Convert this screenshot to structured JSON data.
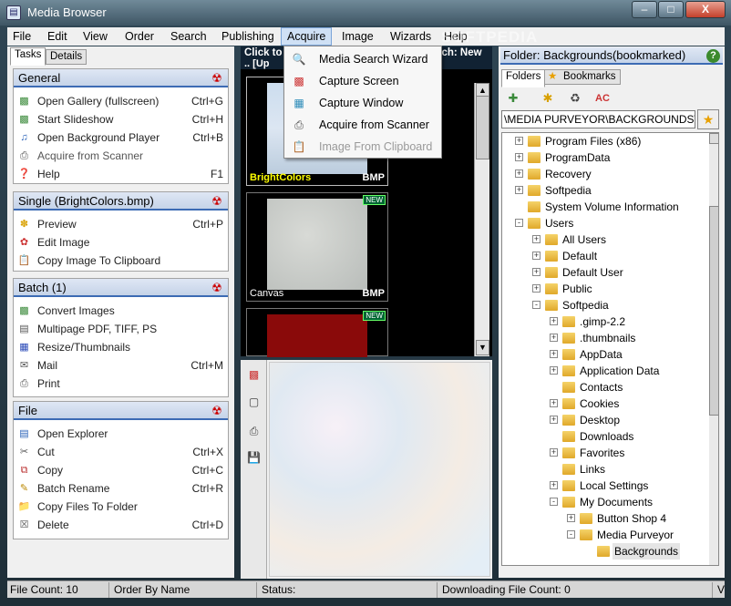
{
  "window": {
    "title": "Media Browser",
    "min_label": "–",
    "max_label": "□",
    "close_label": "X"
  },
  "menu": [
    "File",
    "Edit",
    "View",
    "Order",
    "Search",
    "Publishing",
    "Acquire",
    "Image",
    "Wizards",
    "Help"
  ],
  "watermark": "SOFTPEDIA",
  "left_tabs": [
    "Tasks",
    "Details"
  ],
  "groups": {
    "general": {
      "title": "General",
      "items": [
        {
          "label": "Open Gallery (fullscreen)",
          "shortcut": "Ctrl+G"
        },
        {
          "label": "Start Slideshow",
          "shortcut": "Ctrl+H"
        },
        {
          "label": "Open Background Player",
          "shortcut": "Ctrl+B"
        },
        {
          "label": "Acquire from Scanner",
          "shortcut": ""
        },
        {
          "label": "Help",
          "shortcut": "F1"
        }
      ]
    },
    "single": {
      "title": "Single (BrightColors.bmp)",
      "items": [
        {
          "label": "Preview",
          "shortcut": "Ctrl+P"
        },
        {
          "label": "Edit Image",
          "shortcut": ""
        },
        {
          "label": "Copy Image To Clipboard",
          "shortcut": ""
        }
      ]
    },
    "batch": {
      "title": "Batch (1)",
      "items": [
        {
          "label": "Convert Images",
          "shortcut": ""
        },
        {
          "label": "Multipage PDF, TIFF, PS",
          "shortcut": ""
        },
        {
          "label": "Resize/Thumbnails",
          "shortcut": ""
        },
        {
          "label": "Mail",
          "shortcut": "Ctrl+M"
        },
        {
          "label": "Print",
          "shortcut": ""
        }
      ]
    },
    "file": {
      "title": "File",
      "items": [
        {
          "label": "Open Explorer",
          "shortcut": ""
        },
        {
          "label": "Cut",
          "shortcut": "Ctrl+X"
        },
        {
          "label": "Copy",
          "shortcut": "Ctrl+C"
        },
        {
          "label": "Batch Rename",
          "shortcut": "Ctrl+R"
        },
        {
          "label": "Copy Files To Folder",
          "shortcut": ""
        },
        {
          "label": "Delete",
          "shortcut": "Ctrl+D"
        }
      ]
    }
  },
  "mid": {
    "header1": "Click to",
    "header1_right": "rch: New",
    "header2": ".. [Up",
    "thumbs": [
      {
        "name": "BrightColors",
        "ext": "BMP",
        "new": ""
      },
      {
        "name": "Canvas",
        "ext": "BMP",
        "new": "NEW"
      },
      {
        "name": "",
        "ext": "",
        "new": "NEW"
      }
    ]
  },
  "acquire_menu": [
    {
      "label": "Media Search Wizard",
      "enabled": true
    },
    {
      "label": "Capture Screen",
      "enabled": true
    },
    {
      "label": "Capture Window",
      "enabled": true
    },
    {
      "label": "Acquire from Scanner",
      "enabled": true
    },
    {
      "label": "Image From Clipboard",
      "enabled": false
    }
  ],
  "right": {
    "folder_title": "Folder: Backgrounds(bookmarked)",
    "help": "?",
    "tabs": [
      "Folders",
      "Bookmarks"
    ],
    "path": "\\MEDIA PURVEYOR\\BACKGROUNDS\\",
    "tree": [
      {
        "label": "Program Files (x86)",
        "level": 0,
        "exp": "+"
      },
      {
        "label": "ProgramData",
        "level": 0,
        "exp": "+"
      },
      {
        "label": "Recovery",
        "level": 0,
        "exp": "+"
      },
      {
        "label": "Softpedia",
        "level": 0,
        "exp": "+"
      },
      {
        "label": "System Volume Information",
        "level": 0,
        "exp": ""
      },
      {
        "label": "Users",
        "level": 0,
        "exp": "-"
      },
      {
        "label": "All Users",
        "level": 1,
        "exp": "+"
      },
      {
        "label": "Default",
        "level": 1,
        "exp": "+"
      },
      {
        "label": "Default User",
        "level": 1,
        "exp": "+"
      },
      {
        "label": "Public",
        "level": 1,
        "exp": "+"
      },
      {
        "label": "Softpedia",
        "level": 1,
        "exp": "-"
      },
      {
        "label": ".gimp-2.2",
        "level": 2,
        "exp": "+"
      },
      {
        "label": ".thumbnails",
        "level": 2,
        "exp": "+"
      },
      {
        "label": "AppData",
        "level": 2,
        "exp": "+"
      },
      {
        "label": "Application Data",
        "level": 2,
        "exp": "+"
      },
      {
        "label": "Contacts",
        "level": 2,
        "exp": ""
      },
      {
        "label": "Cookies",
        "level": 2,
        "exp": "+"
      },
      {
        "label": "Desktop",
        "level": 2,
        "exp": "+"
      },
      {
        "label": "Downloads",
        "level": 2,
        "exp": ""
      },
      {
        "label": "Favorites",
        "level": 2,
        "exp": "+"
      },
      {
        "label": "Links",
        "level": 2,
        "exp": ""
      },
      {
        "label": "Local Settings",
        "level": 2,
        "exp": "+"
      },
      {
        "label": "My Documents",
        "level": 2,
        "exp": "-"
      },
      {
        "label": "Button Shop 4",
        "level": 3,
        "exp": "+"
      },
      {
        "label": "Media Purveyor",
        "level": 3,
        "exp": "-"
      },
      {
        "label": "Backgrounds",
        "level": 4,
        "exp": "",
        "selected": true
      }
    ]
  },
  "status": {
    "file_count": "File Count: 10",
    "order": "Order By Name",
    "status": "Status:",
    "downloading": "Downloading File Count: 0",
    "end": "V"
  },
  "colors": {
    "accent": "#3c6bb4",
    "menu_highlight": "#cfe0f5",
    "title_bg": "#3e5564"
  }
}
